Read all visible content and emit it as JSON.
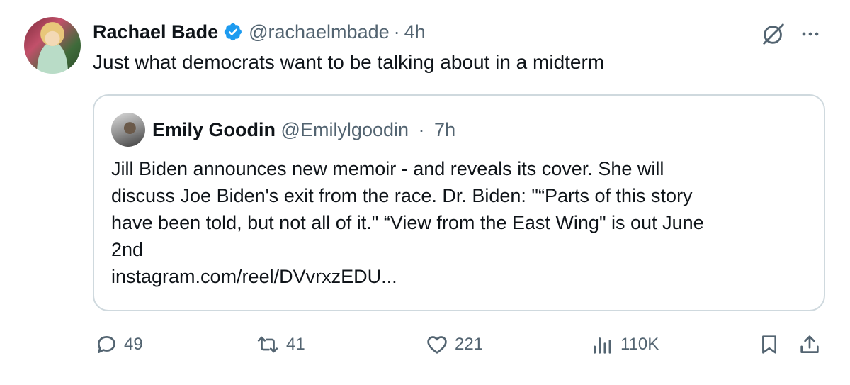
{
  "tweet": {
    "author": {
      "name": "Rachael Bade",
      "handle": "@rachaelmbade",
      "separator": "·",
      "time": "4h",
      "verified": true,
      "verified_color": "#1d9bf0"
    },
    "text": "Just what democrats want to be talking about in a midterm"
  },
  "quoted_tweet": {
    "author": {
      "name": "Emily Goodin",
      "handle": "@Emilylgoodin",
      "separator": "·",
      "time": "7h"
    },
    "text_lines": [
      "Jill Biden announces new memoir - and reveals its cover. She will",
      "discuss Joe Biden's exit from the race. Dr. Biden: \"“Parts of this story",
      "have been told, but not all of it.\" “View from the East Wing\" is out June",
      "2nd",
      "instagram.com/reel/DVvrxzEDU..."
    ]
  },
  "actions": {
    "replies": "49",
    "reposts": "41",
    "likes": "221",
    "views": "110K"
  },
  "icons": {
    "reply": "reply-icon",
    "repost": "repost-icon",
    "like": "heart-icon",
    "views": "views-icon",
    "bookmark": "bookmark-icon",
    "share": "share-icon",
    "grok": "grok-icon",
    "more": "more-icon"
  },
  "colors": {
    "text_primary": "#0f1419",
    "text_secondary": "#536471",
    "border": "#cfd9de",
    "verified": "#1d9bf0"
  }
}
